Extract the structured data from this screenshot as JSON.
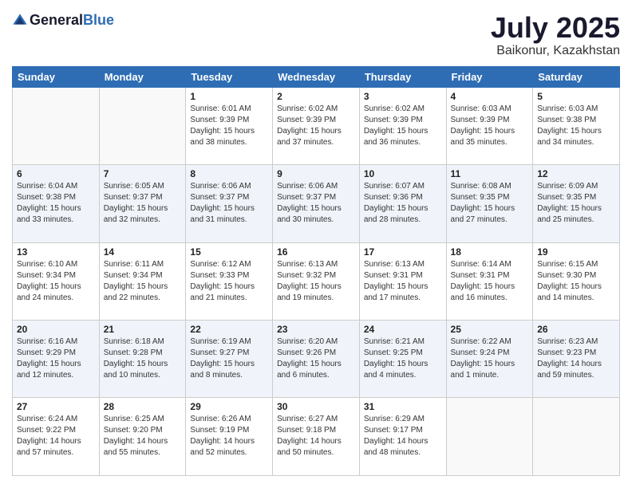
{
  "header": {
    "logo_general": "General",
    "logo_blue": "Blue",
    "month": "July 2025",
    "location": "Baikonur, Kazakhstan"
  },
  "days_of_week": [
    "Sunday",
    "Monday",
    "Tuesday",
    "Wednesday",
    "Thursday",
    "Friday",
    "Saturday"
  ],
  "weeks": [
    [
      {
        "day": "",
        "sunrise": "",
        "sunset": "",
        "daylight": ""
      },
      {
        "day": "",
        "sunrise": "",
        "sunset": "",
        "daylight": ""
      },
      {
        "day": "1",
        "sunrise": "Sunrise: 6:01 AM",
        "sunset": "Sunset: 9:39 PM",
        "daylight": "Daylight: 15 hours and 38 minutes."
      },
      {
        "day": "2",
        "sunrise": "Sunrise: 6:02 AM",
        "sunset": "Sunset: 9:39 PM",
        "daylight": "Daylight: 15 hours and 37 minutes."
      },
      {
        "day": "3",
        "sunrise": "Sunrise: 6:02 AM",
        "sunset": "Sunset: 9:39 PM",
        "daylight": "Daylight: 15 hours and 36 minutes."
      },
      {
        "day": "4",
        "sunrise": "Sunrise: 6:03 AM",
        "sunset": "Sunset: 9:39 PM",
        "daylight": "Daylight: 15 hours and 35 minutes."
      },
      {
        "day": "5",
        "sunrise": "Sunrise: 6:03 AM",
        "sunset": "Sunset: 9:38 PM",
        "daylight": "Daylight: 15 hours and 34 minutes."
      }
    ],
    [
      {
        "day": "6",
        "sunrise": "Sunrise: 6:04 AM",
        "sunset": "Sunset: 9:38 PM",
        "daylight": "Daylight: 15 hours and 33 minutes."
      },
      {
        "day": "7",
        "sunrise": "Sunrise: 6:05 AM",
        "sunset": "Sunset: 9:37 PM",
        "daylight": "Daylight: 15 hours and 32 minutes."
      },
      {
        "day": "8",
        "sunrise": "Sunrise: 6:06 AM",
        "sunset": "Sunset: 9:37 PM",
        "daylight": "Daylight: 15 hours and 31 minutes."
      },
      {
        "day": "9",
        "sunrise": "Sunrise: 6:06 AM",
        "sunset": "Sunset: 9:37 PM",
        "daylight": "Daylight: 15 hours and 30 minutes."
      },
      {
        "day": "10",
        "sunrise": "Sunrise: 6:07 AM",
        "sunset": "Sunset: 9:36 PM",
        "daylight": "Daylight: 15 hours and 28 minutes."
      },
      {
        "day": "11",
        "sunrise": "Sunrise: 6:08 AM",
        "sunset": "Sunset: 9:35 PM",
        "daylight": "Daylight: 15 hours and 27 minutes."
      },
      {
        "day": "12",
        "sunrise": "Sunrise: 6:09 AM",
        "sunset": "Sunset: 9:35 PM",
        "daylight": "Daylight: 15 hours and 25 minutes."
      }
    ],
    [
      {
        "day": "13",
        "sunrise": "Sunrise: 6:10 AM",
        "sunset": "Sunset: 9:34 PM",
        "daylight": "Daylight: 15 hours and 24 minutes."
      },
      {
        "day": "14",
        "sunrise": "Sunrise: 6:11 AM",
        "sunset": "Sunset: 9:34 PM",
        "daylight": "Daylight: 15 hours and 22 minutes."
      },
      {
        "day": "15",
        "sunrise": "Sunrise: 6:12 AM",
        "sunset": "Sunset: 9:33 PM",
        "daylight": "Daylight: 15 hours and 21 minutes."
      },
      {
        "day": "16",
        "sunrise": "Sunrise: 6:13 AM",
        "sunset": "Sunset: 9:32 PM",
        "daylight": "Daylight: 15 hours and 19 minutes."
      },
      {
        "day": "17",
        "sunrise": "Sunrise: 6:13 AM",
        "sunset": "Sunset: 9:31 PM",
        "daylight": "Daylight: 15 hours and 17 minutes."
      },
      {
        "day": "18",
        "sunrise": "Sunrise: 6:14 AM",
        "sunset": "Sunset: 9:31 PM",
        "daylight": "Daylight: 15 hours and 16 minutes."
      },
      {
        "day": "19",
        "sunrise": "Sunrise: 6:15 AM",
        "sunset": "Sunset: 9:30 PM",
        "daylight": "Daylight: 15 hours and 14 minutes."
      }
    ],
    [
      {
        "day": "20",
        "sunrise": "Sunrise: 6:16 AM",
        "sunset": "Sunset: 9:29 PM",
        "daylight": "Daylight: 15 hours and 12 minutes."
      },
      {
        "day": "21",
        "sunrise": "Sunrise: 6:18 AM",
        "sunset": "Sunset: 9:28 PM",
        "daylight": "Daylight: 15 hours and 10 minutes."
      },
      {
        "day": "22",
        "sunrise": "Sunrise: 6:19 AM",
        "sunset": "Sunset: 9:27 PM",
        "daylight": "Daylight: 15 hours and 8 minutes."
      },
      {
        "day": "23",
        "sunrise": "Sunrise: 6:20 AM",
        "sunset": "Sunset: 9:26 PM",
        "daylight": "Daylight: 15 hours and 6 minutes."
      },
      {
        "day": "24",
        "sunrise": "Sunrise: 6:21 AM",
        "sunset": "Sunset: 9:25 PM",
        "daylight": "Daylight: 15 hours and 4 minutes."
      },
      {
        "day": "25",
        "sunrise": "Sunrise: 6:22 AM",
        "sunset": "Sunset: 9:24 PM",
        "daylight": "Daylight: 15 hours and 1 minute."
      },
      {
        "day": "26",
        "sunrise": "Sunrise: 6:23 AM",
        "sunset": "Sunset: 9:23 PM",
        "daylight": "Daylight: 14 hours and 59 minutes."
      }
    ],
    [
      {
        "day": "27",
        "sunrise": "Sunrise: 6:24 AM",
        "sunset": "Sunset: 9:22 PM",
        "daylight": "Daylight: 14 hours and 57 minutes."
      },
      {
        "day": "28",
        "sunrise": "Sunrise: 6:25 AM",
        "sunset": "Sunset: 9:20 PM",
        "daylight": "Daylight: 14 hours and 55 minutes."
      },
      {
        "day": "29",
        "sunrise": "Sunrise: 6:26 AM",
        "sunset": "Sunset: 9:19 PM",
        "daylight": "Daylight: 14 hours and 52 minutes."
      },
      {
        "day": "30",
        "sunrise": "Sunrise: 6:27 AM",
        "sunset": "Sunset: 9:18 PM",
        "daylight": "Daylight: 14 hours and 50 minutes."
      },
      {
        "day": "31",
        "sunrise": "Sunrise: 6:29 AM",
        "sunset": "Sunset: 9:17 PM",
        "daylight": "Daylight: 14 hours and 48 minutes."
      },
      {
        "day": "",
        "sunrise": "",
        "sunset": "",
        "daylight": ""
      },
      {
        "day": "",
        "sunrise": "",
        "sunset": "",
        "daylight": ""
      }
    ]
  ]
}
